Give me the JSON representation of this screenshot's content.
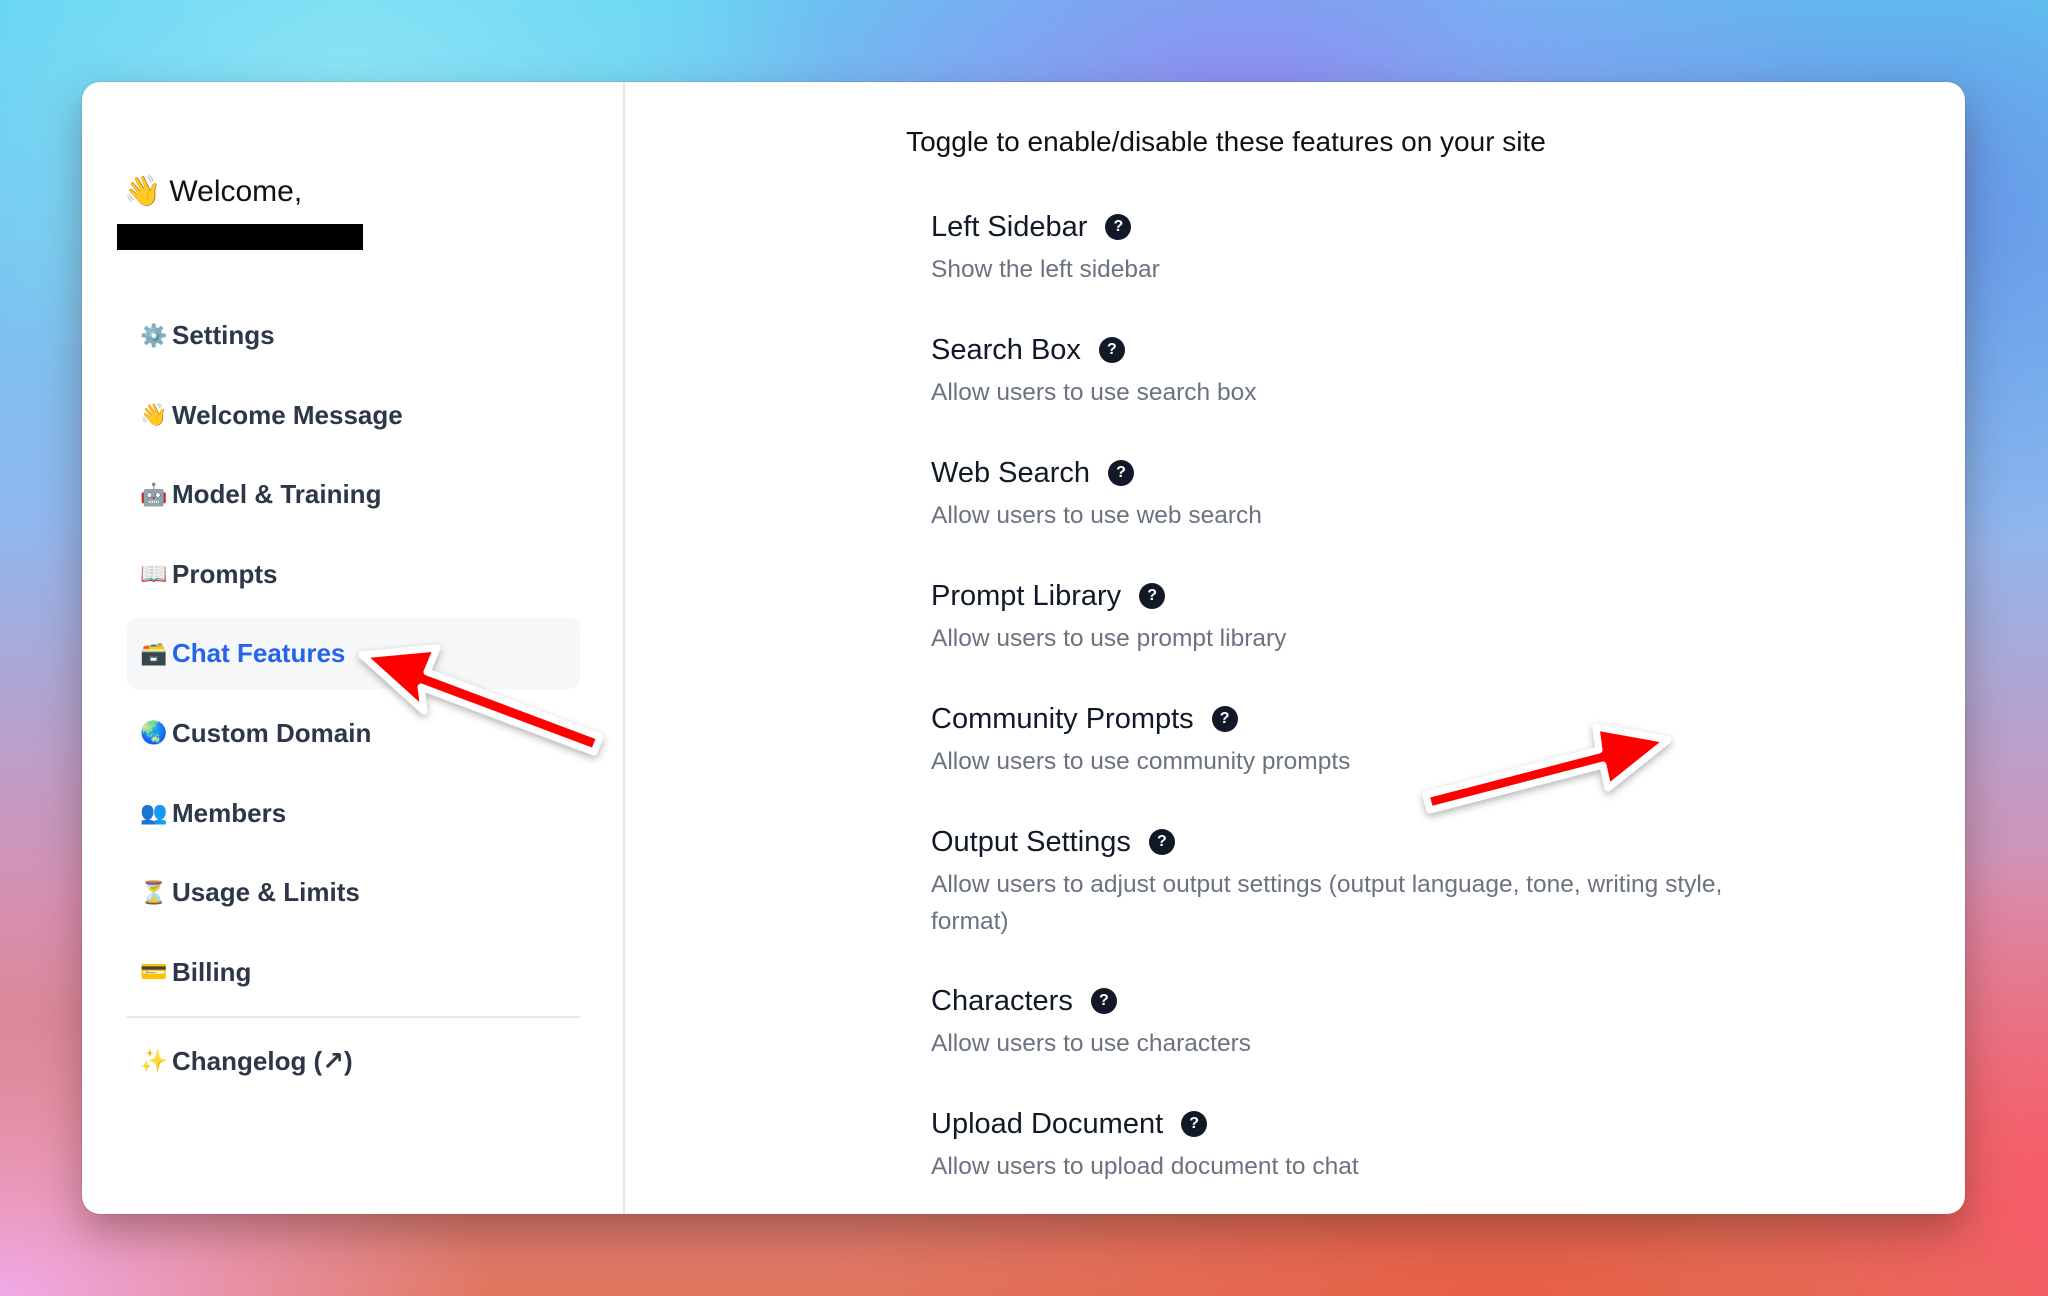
{
  "sidebar": {
    "welcome_emoji": "👋",
    "welcome_text": "Welcome,",
    "redacted_name": "",
    "items": [
      {
        "icon": "⚙️",
        "icon_name": "gear-icon",
        "label": "Settings",
        "active": false
      },
      {
        "icon": "👋",
        "icon_name": "waving-hand-icon",
        "label": "Welcome Message",
        "active": false
      },
      {
        "icon": "🤖",
        "icon_name": "robot-icon",
        "label": "Model & Training",
        "active": false
      },
      {
        "icon": "📖",
        "icon_name": "book-icon",
        "label": "Prompts",
        "active": false
      },
      {
        "icon": "🗃️",
        "icon_name": "card-file-box-icon",
        "label": "Chat Features",
        "active": true
      },
      {
        "icon": "🌏",
        "icon_name": "globe-icon",
        "label": "Custom Domain",
        "active": false
      },
      {
        "icon": "👥",
        "icon_name": "members-icon",
        "label": "Members",
        "active": false
      },
      {
        "icon": "⏳",
        "icon_name": "hourglass-icon",
        "label": "Usage & Limits",
        "active": false
      },
      {
        "icon": "💳",
        "icon_name": "credit-card-icon",
        "label": "Billing",
        "active": false
      }
    ],
    "changelog": {
      "icon": "✨",
      "icon_name": "sparkles-icon",
      "label": "Changelog (↗)"
    }
  },
  "main": {
    "header": "Toggle to enable/disable these features on your site",
    "help_glyph": "?",
    "features": [
      {
        "title": "Left Sidebar",
        "description": "Show the left sidebar",
        "enabled": true
      },
      {
        "title": "Search Box",
        "description": "Allow users to use search box",
        "enabled": true
      },
      {
        "title": "Web Search",
        "description": "Allow users to use web search",
        "enabled": true
      },
      {
        "title": "Prompt Library",
        "description": "Allow users to use prompt library",
        "enabled": true
      },
      {
        "title": "Community Prompts",
        "description": "Allow users to use community prompts",
        "enabled": false
      },
      {
        "title": "Output Settings",
        "description": "Allow users to adjust output settings (output language, tone, writing style, format)",
        "enabled": true
      },
      {
        "title": "Characters",
        "description": "Allow users to use characters",
        "enabled": true
      },
      {
        "title": "Upload Document",
        "description": "Allow users to upload document to chat",
        "enabled": true
      }
    ]
  },
  "colors": {
    "accent": "#2563EB",
    "toggle_off": "#E5E7EB",
    "annotation_arrow": "#FF0000",
    "title_text": "#111827",
    "description_text": "#6B7280"
  },
  "annotations": [
    {
      "type": "arrow",
      "points_to": "Chat Features sidebar item"
    },
    {
      "type": "arrow",
      "points_to": "Community Prompts toggle"
    }
  ]
}
